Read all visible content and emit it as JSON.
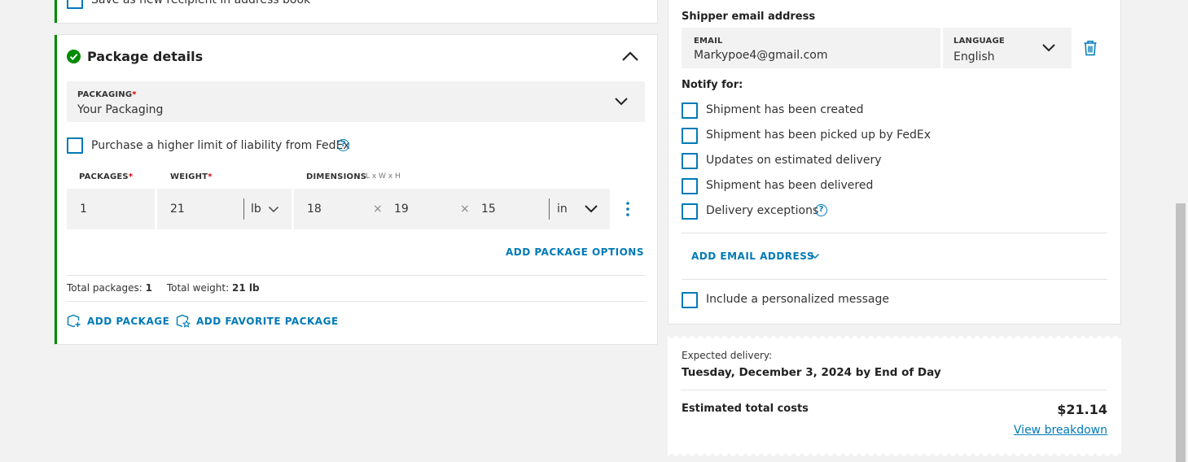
{
  "address": {
    "save_recipient": "Save as new recipient in address book"
  },
  "package": {
    "title": "Package details",
    "packaging_label": "PACKAGING",
    "required_mark": "*",
    "packaging_value": "Your Packaging",
    "liability": "Purchase a higher limit of liability from FedEx",
    "help_glyph": "?",
    "col_packages": "PACKAGES",
    "col_weight": "WEIGHT",
    "col_dimensions": "DIMENSIONS",
    "dimensions_hint": "L x W x H",
    "packages_value": "1",
    "weight_value": "21",
    "weight_unit": "lb",
    "dim_l": "18",
    "dim_w": "19",
    "dim_h": "15",
    "times": "×",
    "dim_unit": "in",
    "add_options": "ADD PACKAGE OPTIONS",
    "total_packages_label": "Total packages:",
    "total_packages_value": "1",
    "total_weight_label": "Total weight:",
    "total_weight_value": "21 lb",
    "add_package": "ADD PACKAGE",
    "add_favorite": "ADD FAVORITE PACKAGE"
  },
  "notify": {
    "shipper_email_title": "Shipper email address",
    "email_label": "EMAIL",
    "email_value": "Markypoe4@gmail.com",
    "language_label": "LANGUAGE",
    "language_value": "English",
    "notify_for": "Notify for:",
    "options": [
      "Shipment has been created",
      "Shipment has been picked up by FedEx",
      "Updates on estimated delivery",
      "Shipment has been delivered",
      "Delivery exceptions"
    ],
    "add_email": "ADD EMAIL ADDRESS",
    "personal_message": "Include a personalized message"
  },
  "summary": {
    "expected_label": "Expected delivery:",
    "expected_value": "Tuesday, December 3, 2024 by End of Day",
    "total_label": "Estimated total costs",
    "total_value": "$21.14",
    "breakdown": "View breakdown"
  },
  "colors": {
    "accent": "#007ab7",
    "success": "#008a00",
    "required": "#d70000"
  }
}
